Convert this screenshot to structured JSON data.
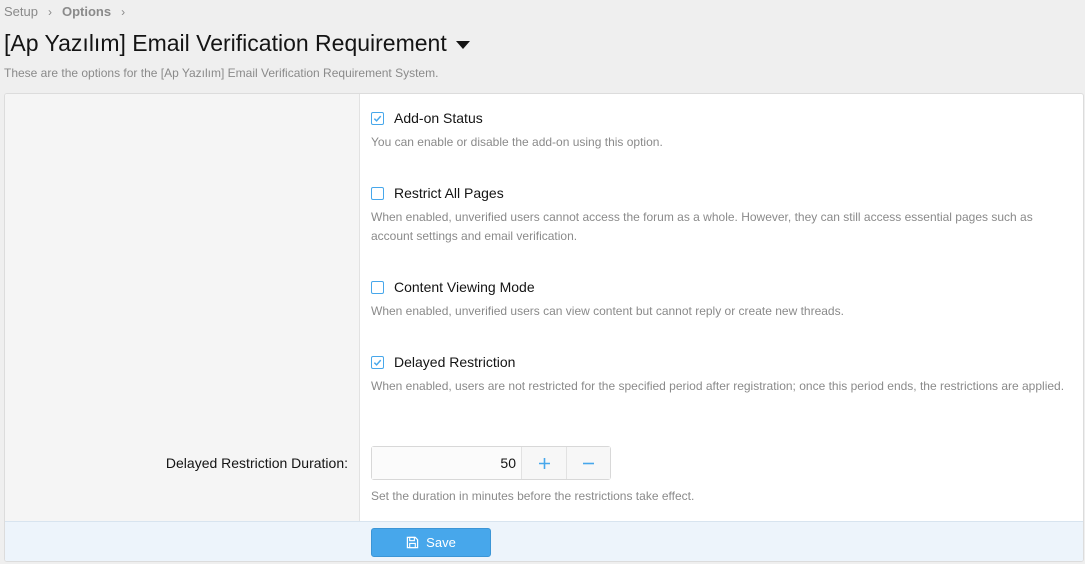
{
  "breadcrumb": {
    "items": [
      "Setup",
      "Options"
    ]
  },
  "header": {
    "title": "[Ap Yazılım] Email Verification Requirement",
    "description": "These are the options for the [Ap Yazılım] Email Verification Requirement System."
  },
  "options": [
    {
      "label": "Add-on Status",
      "checked": true,
      "hint": "You can enable or disable the add-on using this option."
    },
    {
      "label": "Restrict All Pages",
      "checked": false,
      "hint": "When enabled, unverified users cannot access the forum as a whole. However, they can still access essential pages such as account settings and email verification."
    },
    {
      "label": "Content Viewing Mode",
      "checked": false,
      "hint": "When enabled, unverified users can view content but cannot reply or create new threads."
    },
    {
      "label": "Delayed Restriction",
      "checked": true,
      "hint": "When enabled, users are not restricted for the specified period after registration; once this period ends, the restrictions are applied."
    }
  ],
  "duration": {
    "label": "Delayed Restriction Duration:",
    "value": "50",
    "hint": "Set the duration in minutes before the restrictions take effect."
  },
  "footer": {
    "save_label": "Save"
  },
  "icons": {
    "breadcrumb_separator": "chevron-right-icon",
    "title_menu": "caret-down-icon",
    "checkbox_checked": "check-icon",
    "increment": "plus-icon",
    "decrement": "minus-icon",
    "save": "floppy-disk-icon"
  },
  "colors": {
    "accent": "#47a7eb",
    "footer_bg": "#edf4fb"
  }
}
